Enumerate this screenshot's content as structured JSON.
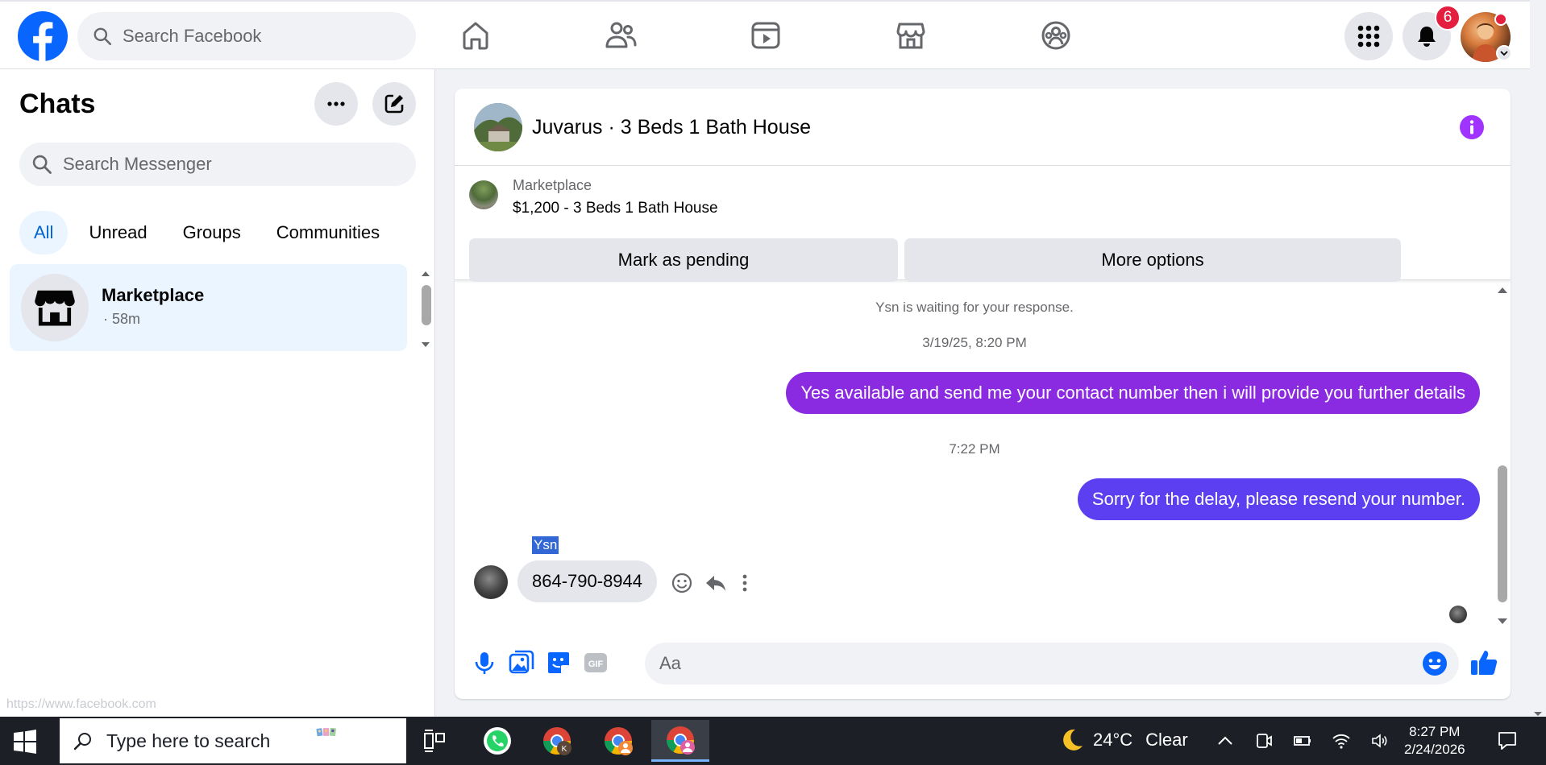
{
  "topbar": {
    "search_placeholder": "Search Facebook",
    "notification_count": "6"
  },
  "left": {
    "title": "Chats",
    "search_placeholder": "Search Messenger",
    "filters": [
      "All",
      "Unread",
      "Groups",
      "Communities"
    ],
    "active_filter": "All",
    "chat": {
      "name": "Marketplace",
      "time": "· 58m"
    },
    "status_url": "https://www.facebook.com"
  },
  "conversation": {
    "title": "Juvarus · 3 Beds 1 Bath House",
    "listing_source": "Marketplace",
    "listing_price": "$1,200 - 3 Beds 1 Bath House",
    "mark_pending": "Mark as pending",
    "more_options": "More options",
    "waiting": "Ysn is waiting for your response.",
    "messages": [
      {
        "type": "timestamp",
        "text": "3/19/25, 8:20 PM"
      },
      {
        "type": "outgoing",
        "text": "Yes available and send me your contact number then i will provide you further details",
        "color": "#8a2be2"
      },
      {
        "type": "timestamp",
        "text": "7:22 PM"
      },
      {
        "type": "outgoing",
        "text": "Sorry for the delay, please resend your number.",
        "color": "#5b3ff0"
      },
      {
        "type": "incoming",
        "sender": "Ysn",
        "text": "864-790-8944"
      }
    ],
    "composer_placeholder": "Aa"
  },
  "taskbar": {
    "search_placeholder": "Type here to search",
    "temperature": "24°C",
    "weather": "Clear",
    "time": "8:27 PM",
    "date": "2/24/2026"
  },
  "colors": {
    "facebook_blue": "#0866ff",
    "messenger_purple": "#a033ff",
    "active_chat_bg": "#ebf5ff",
    "notification_red": "#e41e3f"
  }
}
